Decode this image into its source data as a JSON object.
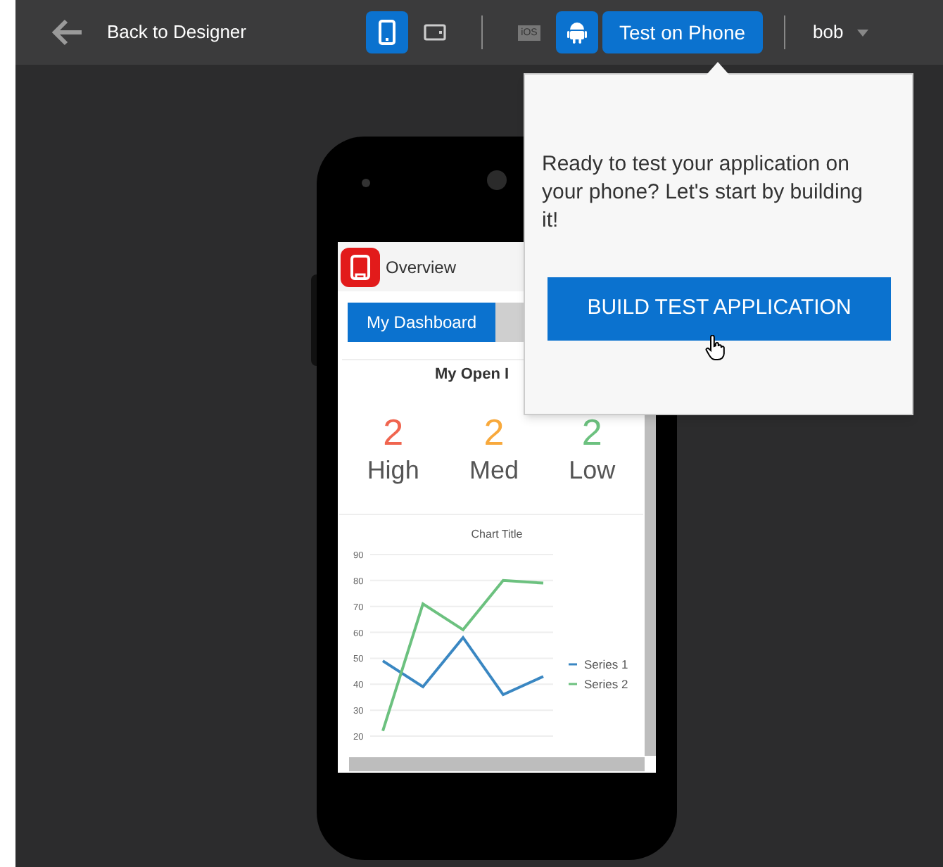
{
  "toolbar": {
    "back_label": "Back to Designer",
    "devices": [
      {
        "kind": "phone",
        "selected": true
      },
      {
        "kind": "tablet",
        "selected": false
      }
    ],
    "platforms": [
      {
        "kind": "ios",
        "label": "iOS",
        "selected": false
      },
      {
        "kind": "android",
        "selected": true
      }
    ],
    "test_button": "Test on Phone",
    "user": "bob"
  },
  "phone_app": {
    "title": "Overview",
    "tabs": [
      {
        "label": "My Dashboard",
        "selected": true
      },
      {
        "selected": false
      }
    ],
    "summary": {
      "title": "My Open I",
      "counts": [
        {
          "value": "2",
          "label": "High",
          "color": "#f0654f"
        },
        {
          "value": "2",
          "label": "Med",
          "color": "#f8a93c"
        },
        {
          "value": "2",
          "label": "Low",
          "color": "#6cc17f"
        }
      ]
    },
    "chart_data": {
      "type": "line",
      "title": "Chart Title",
      "yticks": [
        20,
        30,
        40,
        50,
        60,
        70,
        80,
        90
      ],
      "ylim": [
        20,
        90
      ],
      "grid": true,
      "legend": "right",
      "series": [
        {
          "name": "Series 1",
          "color": "#3a87c2",
          "values": [
            49,
            39,
            58,
            36,
            43
          ]
        },
        {
          "name": "Series 2",
          "color": "#6cc17f",
          "values": [
            22,
            71,
            61,
            80,
            79
          ]
        }
      ]
    }
  },
  "popover": {
    "message": "Ready to test your application on your phone? Let's start by building it!",
    "button": "BUILD TEST APPLICATION"
  }
}
